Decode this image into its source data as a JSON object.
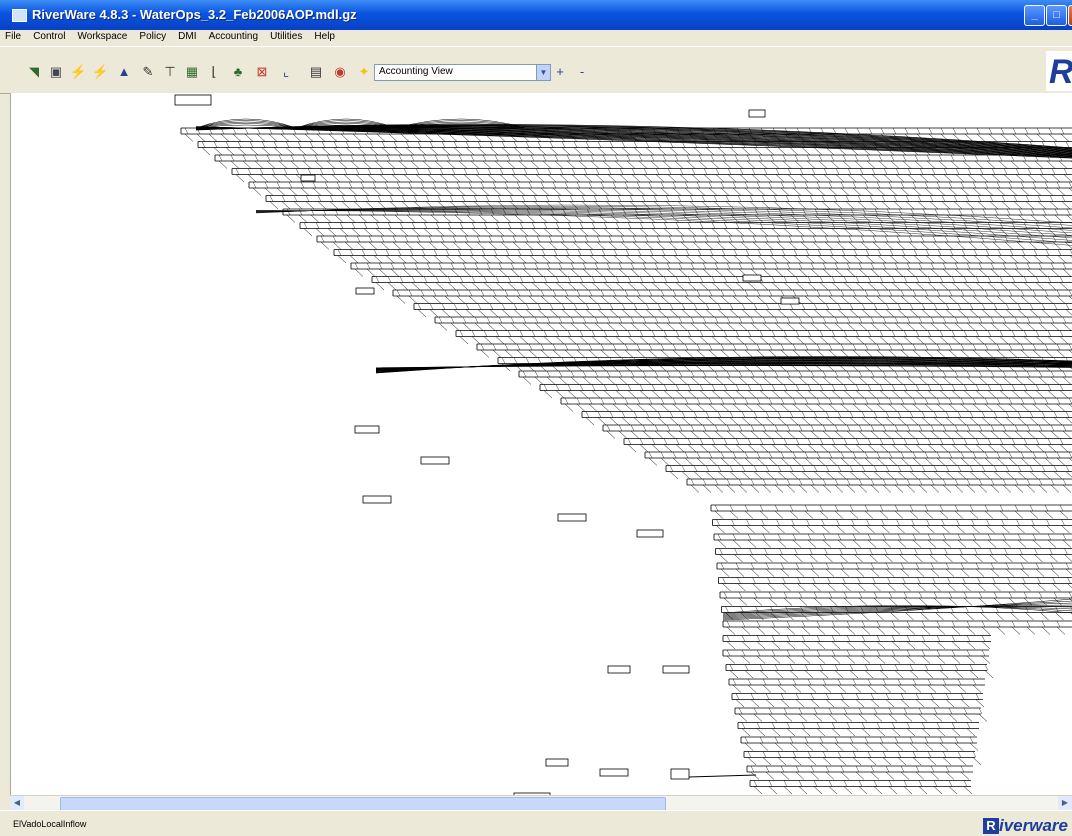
{
  "window": {
    "title": "RiverWare 4.8.3 - WaterOps_3.2_Feb2006AOP.mdl.gz",
    "controls": {
      "minimize": "_",
      "maximize": "□",
      "close": "✕"
    }
  },
  "menubar": {
    "items": [
      "File",
      "Control",
      "Workspace",
      "Policy",
      "DMI",
      "Accounting",
      "Utilities",
      "Help"
    ]
  },
  "toolbar": {
    "icons": [
      "open-icon",
      "save-icon",
      "run-icon",
      "run-multiple-icon",
      "triangle-icon",
      "wand-icon",
      "link-icon",
      "table-icon",
      "series-icon",
      "hierarchy-icon",
      "chart-icon",
      "plot-icon",
      "data-icon",
      "record-icon",
      "star-icon"
    ],
    "view_selector": {
      "value": "Accounting View"
    },
    "zoom_in_label": "+",
    "zoom_out_label": "-"
  },
  "status": {
    "text": "ElVadoLocalInflow"
  },
  "brand": {
    "letter": "R",
    "word": "iverware"
  }
}
